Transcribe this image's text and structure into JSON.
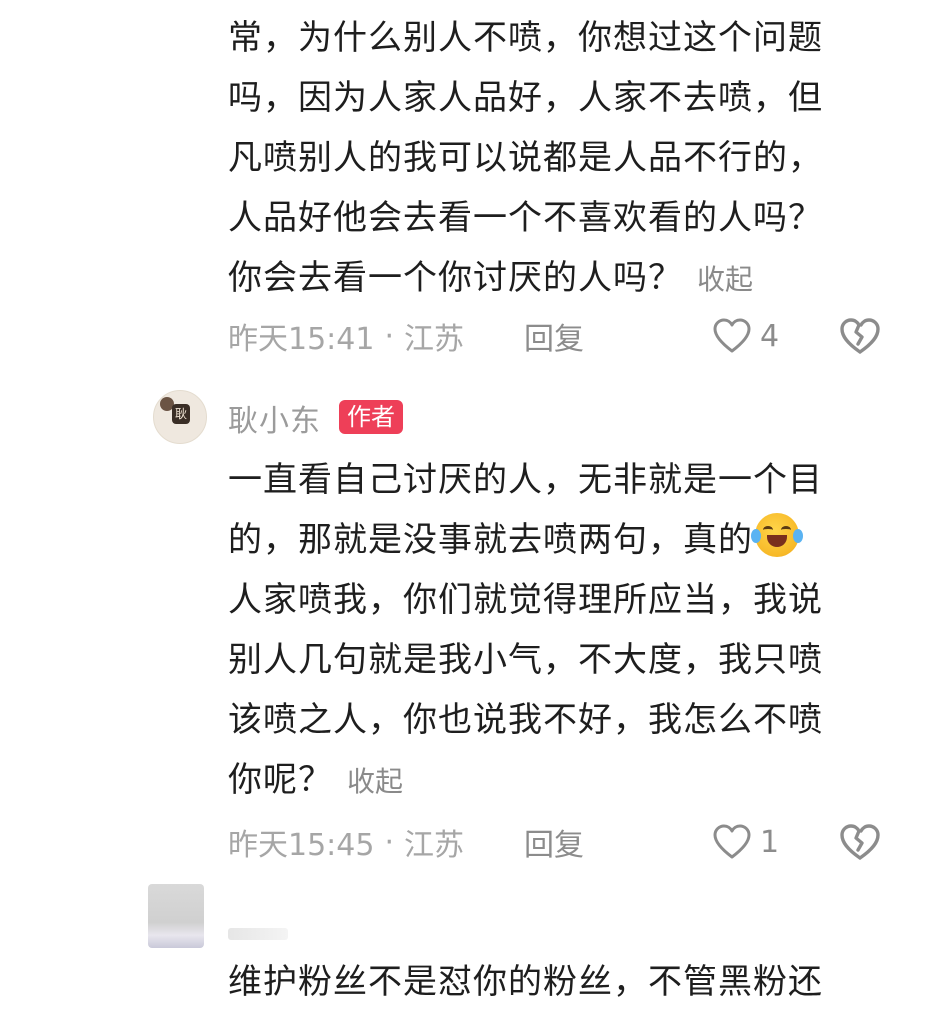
{
  "comment1": {
    "lines": [
      "常，为什么别人不喷，你想过这个问题",
      "吗，因为人家人品好，人家不去喷，但",
      "凡喷别人的我可以说都是人品不行的，",
      "人品好他会去看一个不喜欢看的人吗？",
      "你会去看一个你讨厌的人吗？"
    ],
    "collapse": "收起",
    "time": "昨天15:41",
    "dot": "·",
    "location": "江苏",
    "reply": "回复",
    "likes": "4"
  },
  "comment2": {
    "username": "耿小东",
    "author_tag": "作者",
    "avatar_badge": "耿",
    "lines": [
      "一直看自己讨厌的人，无非就是一个目",
      "的，那就是没事就去喷两句，真的",
      "人家喷我，你们就觉得理所应当，我说",
      "别人几句就是我小气，不大度，我只喷",
      "该喷之人，你也说我不好，我怎么不喷",
      "你呢？"
    ],
    "emoji": "laughing-crying-emoji",
    "collapse": "收起",
    "time": "昨天15:45",
    "dot": "·",
    "location": "江苏",
    "reply": "回复",
    "likes": "1"
  },
  "comment3": {
    "lines": [
      "维护粉丝不是怼你的粉丝，不管黑粉还"
    ]
  },
  "colors": {
    "author_tag_bg": "#ee3f58",
    "meta_text": "#a6a6a6",
    "body_text": "#1e1e1e"
  }
}
